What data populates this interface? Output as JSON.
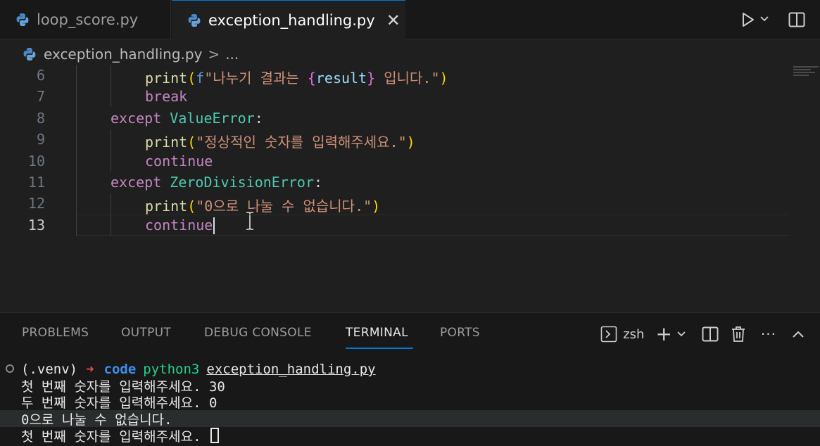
{
  "tabs": [
    {
      "label": "loop_score.py",
      "active": false,
      "icon": "python-icon"
    },
    {
      "label": "exception_handling.py",
      "active": true,
      "icon": "python-icon"
    }
  ],
  "tab_close_glyph": "✕",
  "breadcrumb": {
    "file": "exception_handling.py",
    "separator": ">",
    "more": "..."
  },
  "editor": {
    "current_line": 13,
    "lines": [
      {
        "num": "6",
        "parts": [
          [
            "fn",
            "print"
          ],
          [
            "br1",
            "("
          ],
          [
            "fpre",
            "f"
          ],
          [
            "str",
            "\"나누기 결과는 "
          ],
          [
            "br2",
            "{"
          ],
          [
            "var",
            "result"
          ],
          [
            "br2",
            "}"
          ],
          [
            "str",
            " 입니다.\""
          ],
          [
            "br1",
            ")"
          ]
        ]
      },
      {
        "num": "7",
        "parts": [
          [
            "kw",
            "break"
          ]
        ]
      },
      {
        "num": "8",
        "parts": [
          [
            "kw",
            "except "
          ],
          [
            "cls",
            "ValueError"
          ],
          [
            "plain",
            ":"
          ]
        ]
      },
      {
        "num": "9",
        "parts": [
          [
            "fn",
            "print"
          ],
          [
            "br1",
            "("
          ],
          [
            "str",
            "\"정상적인 숫자를 입력해주세요.\""
          ],
          [
            "br1",
            ")"
          ]
        ]
      },
      {
        "num": "10",
        "parts": [
          [
            "kw",
            "continue"
          ]
        ]
      },
      {
        "num": "11",
        "parts": [
          [
            "kw",
            "except "
          ],
          [
            "cls",
            "ZeroDivisionError"
          ],
          [
            "plain",
            ":"
          ]
        ]
      },
      {
        "num": "12",
        "parts": [
          [
            "fn",
            "print"
          ],
          [
            "br1",
            "("
          ],
          [
            "str",
            "\"0으로 나눌 수 없습니다.\""
          ],
          [
            "br1",
            ")"
          ]
        ]
      },
      {
        "num": "13",
        "parts": [
          [
            "kw",
            "continue"
          ]
        ]
      }
    ]
  },
  "panel": {
    "tabs": [
      "PROBLEMS",
      "OUTPUT",
      "DEBUG CONSOLE",
      "TERMINAL",
      "PORTS"
    ],
    "active_tab": "TERMINAL",
    "shell": "zsh",
    "plus": "+",
    "more": "···"
  },
  "terminal": {
    "prompt_env": "(.venv)",
    "prompt_arrow": "➜",
    "prompt_dir": "code",
    "command": "python3",
    "argument": "exception_handling.py",
    "output": [
      "첫 번째 숫자를 입력해주세요. 30",
      "두 번째 숫자를 입력해주세요. 0",
      "0으로 나눌 수 없습니다.",
      "첫 번째 숫자를 입력해주세요. "
    ]
  },
  "colors": {
    "accent": "#0078d4",
    "keyword": "#c586c0",
    "function": "#dcdcaa",
    "class": "#4ec9b0",
    "string": "#ce9178"
  }
}
